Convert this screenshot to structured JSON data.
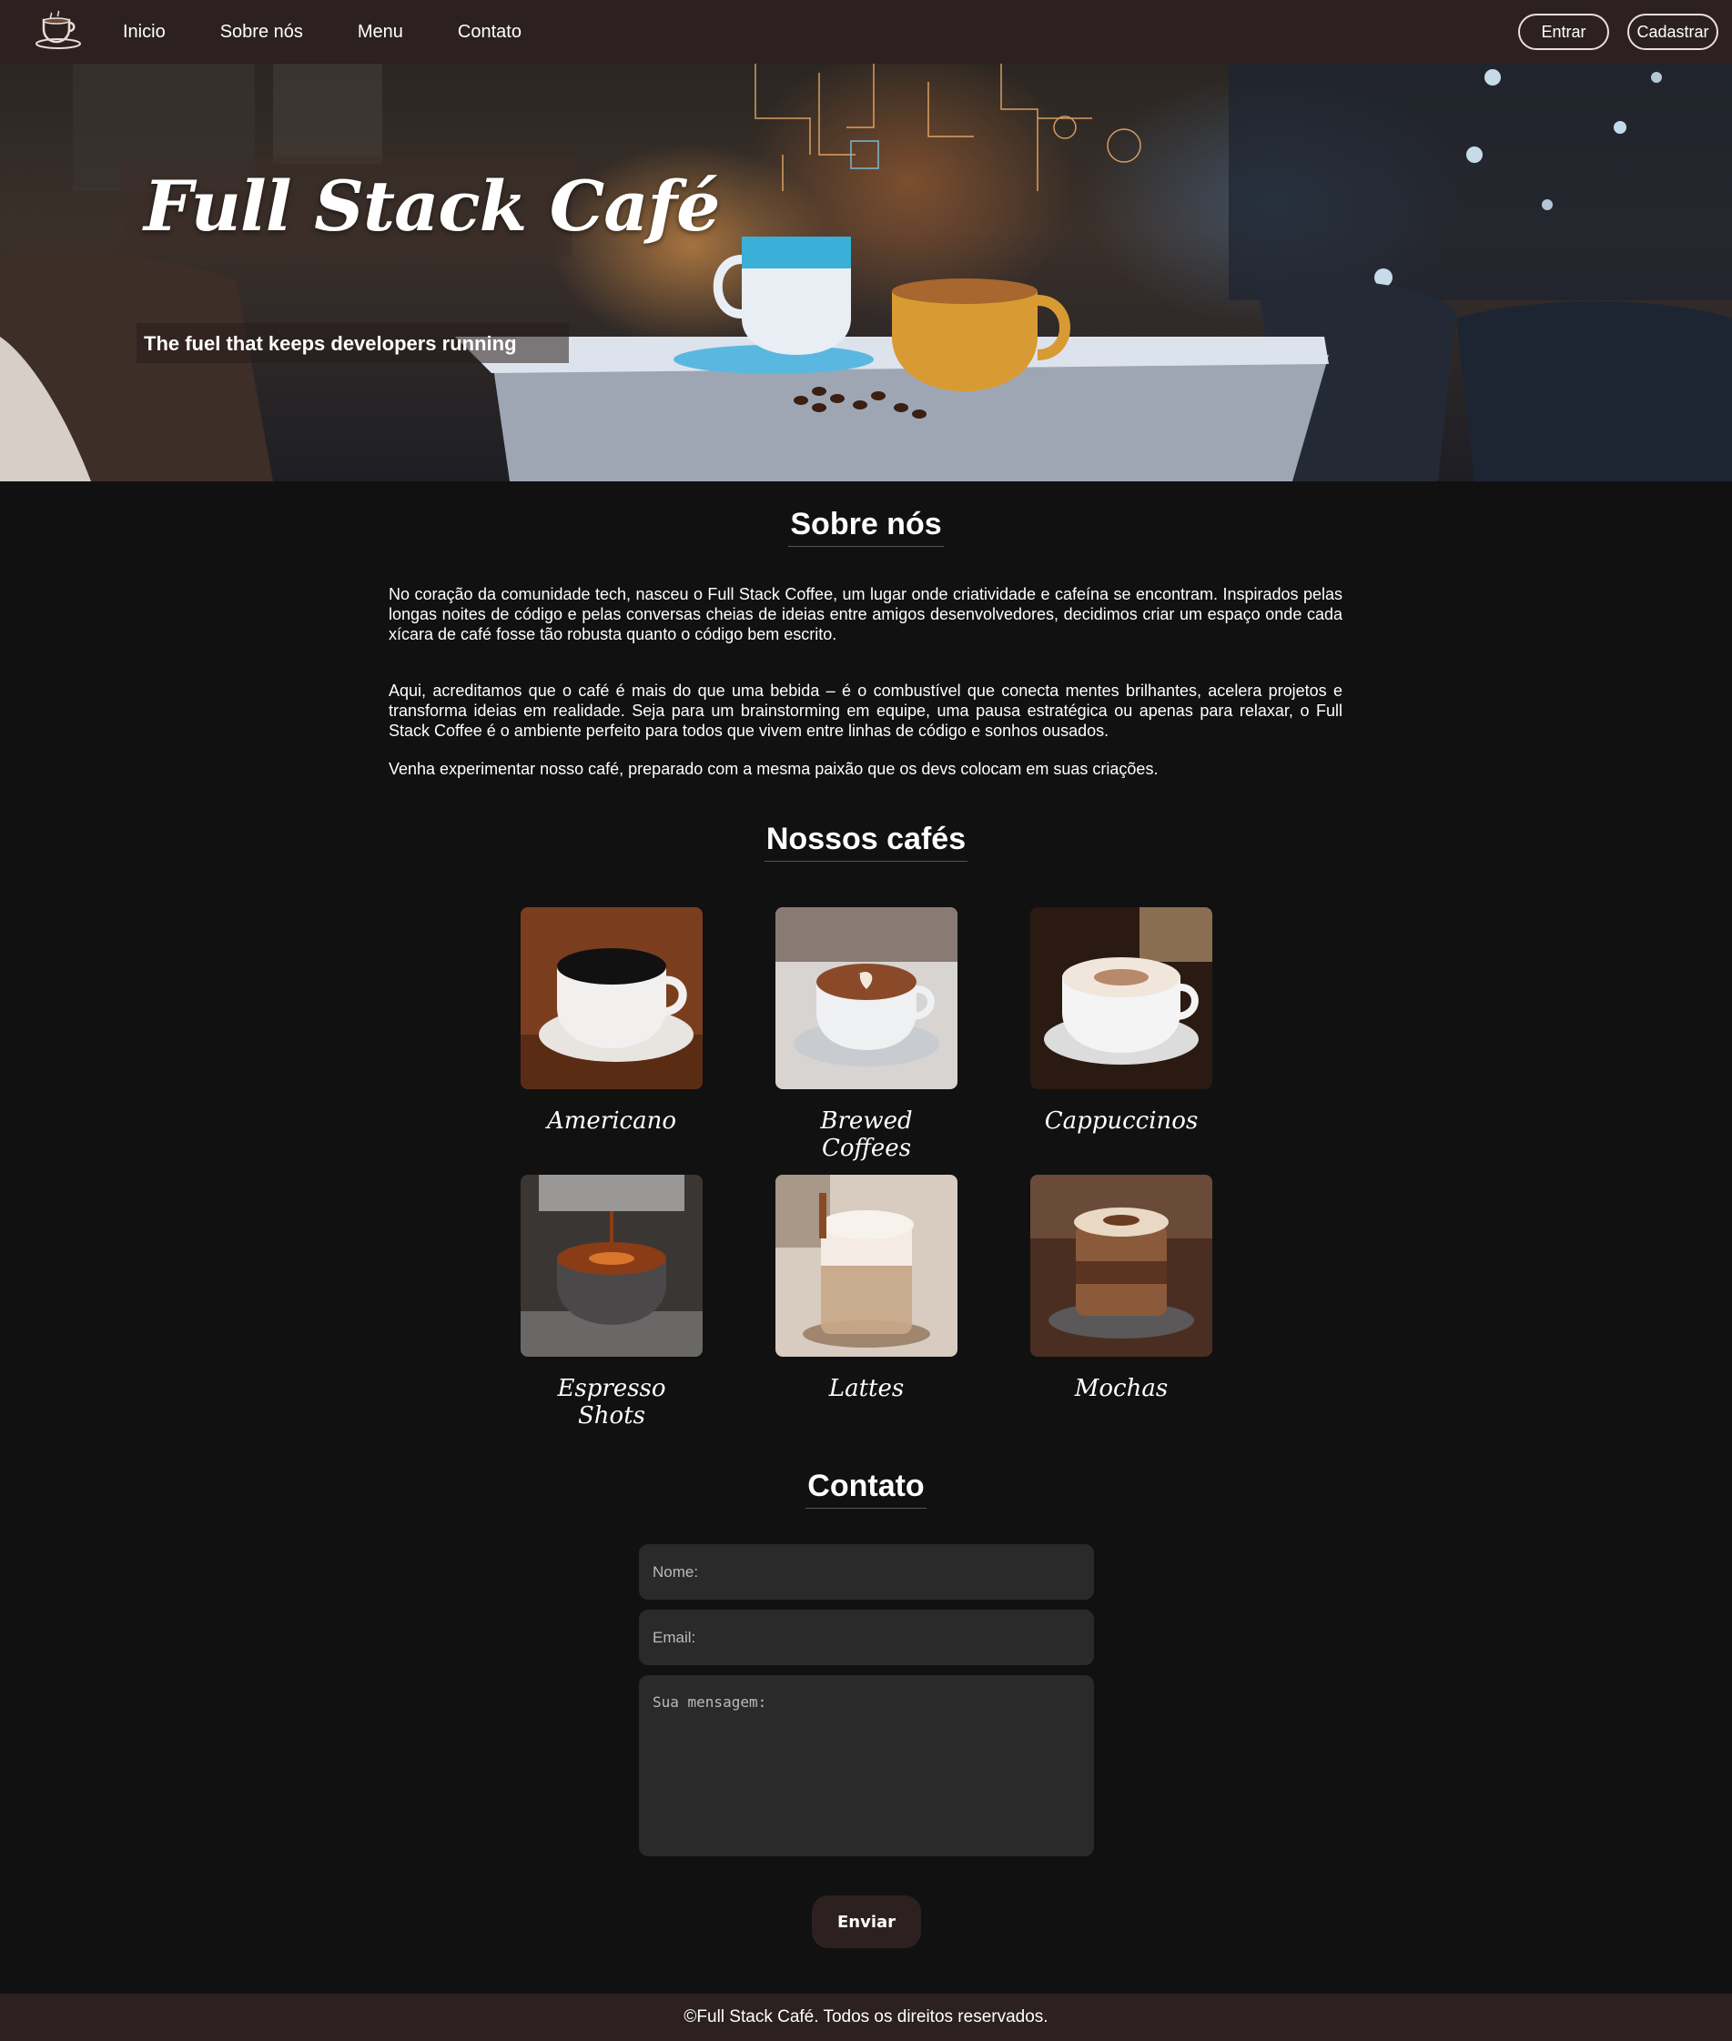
{
  "nav": {
    "links": [
      "Inicio",
      "Sobre nós",
      "Menu",
      "Contato"
    ],
    "login": "Entrar",
    "signup": "Cadastrar",
    "logo_icon": "coffee-cup-icon"
  },
  "hero": {
    "title": "Full Stack Café",
    "subtitle": "The fuel that keeps developers running"
  },
  "about": {
    "title": "Sobre nós",
    "paragraphs": [
      "No coração da comunidade tech, nasceu o Full Stack Coffee, um lugar onde criatividade e cafeína se encontram. Inspirados pelas longas noites de código e pelas conversas cheias de ideias entre amigos desenvolvedores, decidimos criar um espaço onde cada xícara de café fosse tão robusta quanto o código bem escrito.",
      "Aqui, acreditamos que o café é mais do que uma bebida – é o combustível que conecta mentes brilhantes, acelera projetos e transforma ideias em realidade. Seja para um brainstorming em equipe, uma pausa estratégica ou apenas para relaxar, o Full Stack Coffee é o ambiente perfeito para todos que vivem entre linhas de código e sonhos ousados.",
      "Venha experimentar nosso café, preparado com a mesma paixão que os devs colocam em suas criações."
    ]
  },
  "coffees": {
    "title": "Nossos cafés",
    "items": [
      "Americano",
      "Brewed Coffees",
      "Cappuccinos",
      "Espresso Shots",
      "Lattes",
      "Mochas"
    ]
  },
  "contact": {
    "title": "Contato",
    "name_placeholder": "Nome:",
    "email_placeholder": "Email:",
    "message_placeholder": "Sua mensagem:",
    "submit": "Enviar"
  },
  "footer": {
    "text": "©Full Stack Café. Todos os direitos reservados."
  },
  "colors": {
    "background": "#111111",
    "nav_footer": "#2c2020",
    "input": "#2a2a2a"
  }
}
